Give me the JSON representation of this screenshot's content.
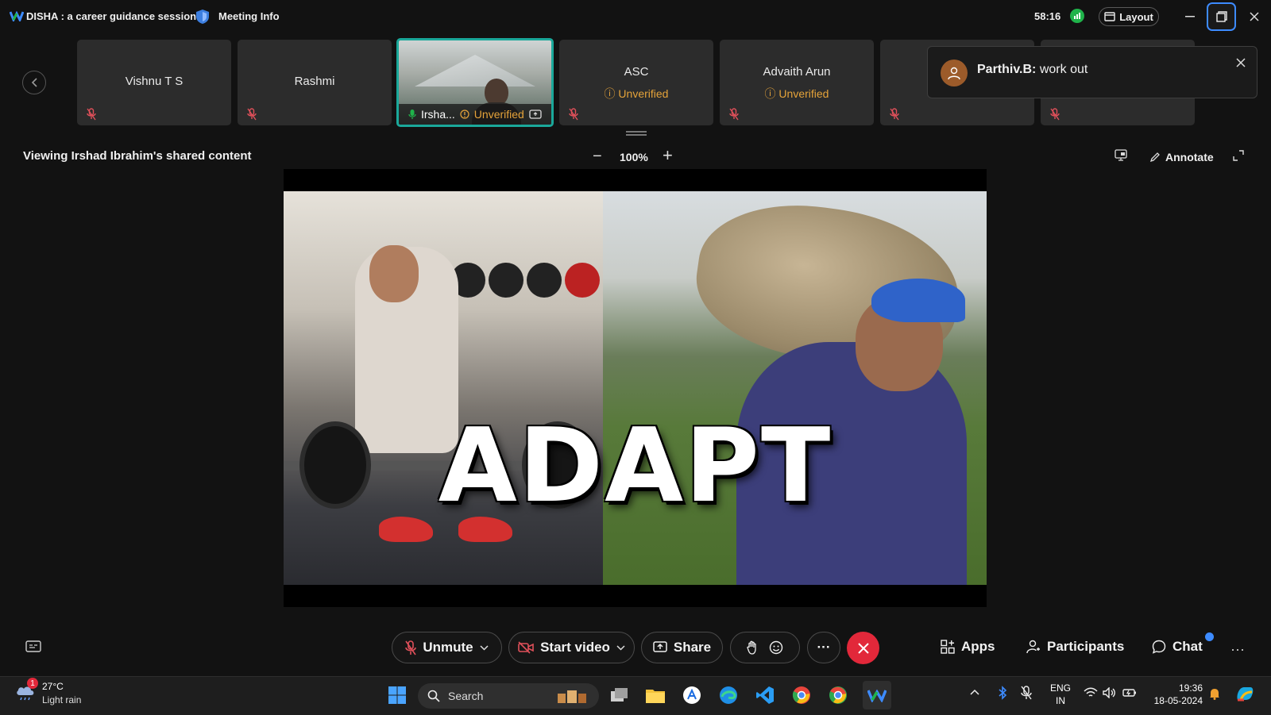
{
  "window": {
    "title": "DISHA : a career guidance session",
    "meeting_info": "Meeting Info",
    "timer": "58:16",
    "layout_label": "Layout"
  },
  "participants": [
    {
      "name": "Vishnu  T S",
      "status": ""
    },
    {
      "name": "Rashmi",
      "status": ""
    },
    {
      "name": "Irsha...",
      "status": "Unverified"
    },
    {
      "name": "ASC",
      "status": "Unverified"
    },
    {
      "name": "Advaith Arun",
      "status": "Unverified"
    },
    {
      "name": "",
      "status": ""
    },
    {
      "name": "",
      "status": ""
    }
  ],
  "toast": {
    "sender": "Parthiv.B:",
    "message": " work out"
  },
  "content": {
    "viewing_label": "Viewing Irshad Ibrahim's shared content",
    "zoom_minus": "−",
    "zoom_level": "100%",
    "zoom_plus": "+",
    "annotate_label": "Annotate",
    "slide_text": "ADAPT"
  },
  "controls": {
    "unmute": "Unmute",
    "start_video": "Start video",
    "share": "Share",
    "more": "···",
    "apps": "Apps",
    "participants": "Participants",
    "chat": "Chat",
    "overflow": "···"
  },
  "taskbar": {
    "weather_badge": "1",
    "temperature": "27°C",
    "condition": "Light rain",
    "search_label": "Search",
    "lang_line1": "ENG",
    "lang_line2": "IN",
    "time": "19:36",
    "date": "18-05-2024"
  },
  "colors": {
    "accent": "#1aa89a",
    "unverified": "#e5a33a",
    "end_call": "#e2283a",
    "muted_icon": "#e0505a",
    "focus": "#3d8bff"
  }
}
